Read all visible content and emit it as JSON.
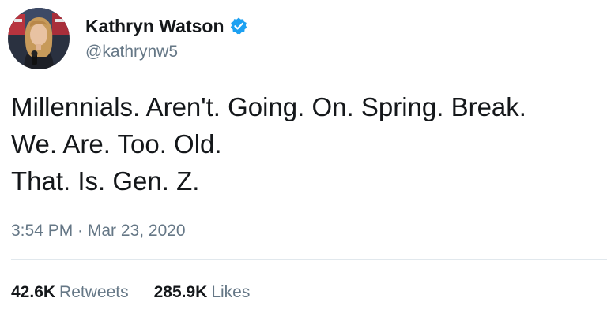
{
  "author": {
    "display_name": "Kathryn Watson",
    "handle": "@kathrynw5",
    "verified_icon": "verified-badge-icon",
    "verified_color": "#1da1f2"
  },
  "tweet": {
    "lines": [
      "Millennials. Aren't. Going. On. Spring. Break.",
      "We. Are. Too. Old.",
      "That. Is. Gen. Z."
    ],
    "timestamp": "3:54 PM · Mar 23, 2020"
  },
  "stats": {
    "retweets_count": "42.6K",
    "retweets_label": "Retweets",
    "likes_count": "285.9K",
    "likes_label": "Likes"
  },
  "colors": {
    "text": "#14171a",
    "secondary": "#657786",
    "divider": "#e1e8ed"
  }
}
